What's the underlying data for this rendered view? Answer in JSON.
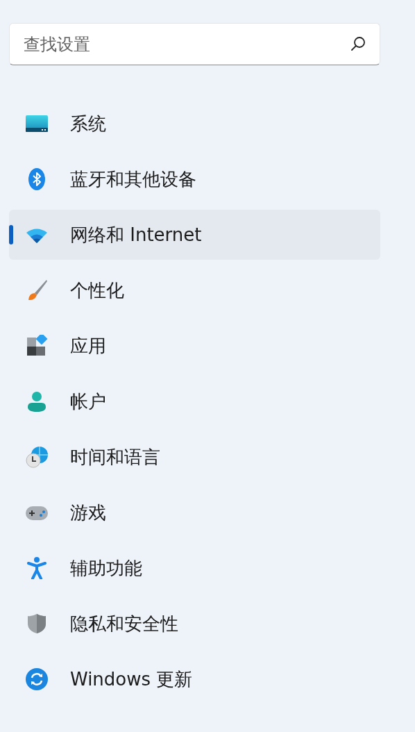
{
  "search": {
    "placeholder": "查找设置"
  },
  "nav": [
    {
      "kind": "system",
      "label": "系统",
      "selected": false
    },
    {
      "kind": "bluetooth",
      "label": "蓝牙和其他设备",
      "selected": false
    },
    {
      "kind": "network",
      "label": "网络和 Internet",
      "selected": true
    },
    {
      "kind": "personalization",
      "label": "个性化",
      "selected": false
    },
    {
      "kind": "apps",
      "label": "应用",
      "selected": false
    },
    {
      "kind": "accounts",
      "label": "帐户",
      "selected": false
    },
    {
      "kind": "time",
      "label": "时间和语言",
      "selected": false
    },
    {
      "kind": "gaming",
      "label": "游戏",
      "selected": false
    },
    {
      "kind": "accessibility",
      "label": "辅助功能",
      "selected": false
    },
    {
      "kind": "privacy",
      "label": "隐私和安全性",
      "selected": false
    },
    {
      "kind": "update",
      "label": "Windows 更新",
      "selected": false
    }
  ]
}
